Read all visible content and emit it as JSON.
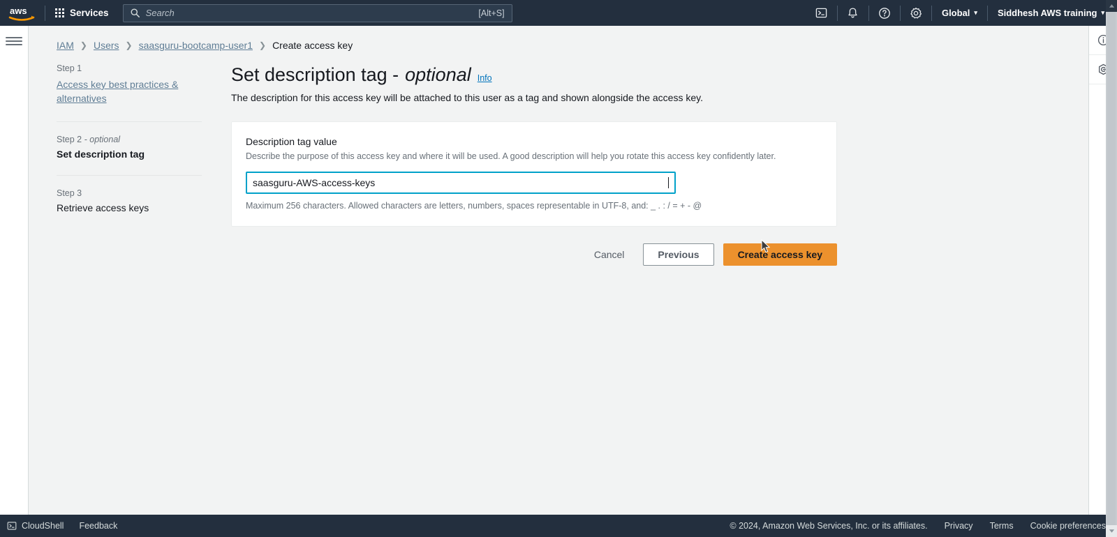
{
  "header": {
    "logo_alt": "aws",
    "services_label": "Services",
    "search": {
      "placeholder": "Search",
      "value": "",
      "shortcut": "[Alt+S]",
      "icon": "search-icon"
    },
    "icons": [
      {
        "name": "cloudshell-icon",
        "label": "CloudShell"
      },
      {
        "name": "bell-icon",
        "label": "Notifications"
      },
      {
        "name": "help-icon",
        "label": "Help"
      },
      {
        "name": "settings-icon",
        "label": "Settings"
      }
    ],
    "region_label": "Global",
    "account_label": "Siddhesh AWS training",
    "caret": "▾"
  },
  "breadcrumb": {
    "items": [
      {
        "label": "IAM",
        "link": true
      },
      {
        "label": "Users",
        "link": true
      },
      {
        "label": "saasguru-bootcamp-user1",
        "link": true
      },
      {
        "label": "Create access key",
        "link": false
      }
    ],
    "separator": "❯"
  },
  "steps": [
    {
      "step_label": "Step 1",
      "optional": false,
      "title": "Access key best practices & alternatives",
      "active": false,
      "link": true
    },
    {
      "step_label": "Step 2",
      "optional": true,
      "optional_text": "- optional",
      "title": "Set description tag",
      "active": true,
      "link": false
    },
    {
      "step_label": "Step 3",
      "optional": false,
      "title": "Retrieve access keys",
      "active": false,
      "link": false
    }
  ],
  "main": {
    "title": "Set description tag -",
    "title_italic": "optional",
    "info_label": "Info",
    "subtitle": "The description for this access key will be attached to this user as a tag and shown alongside the access key.",
    "panel": {
      "field_label": "Description tag value",
      "field_description": "Describe the purpose of this access key and where it will be used. A good description will help you rotate this access key confidently later.",
      "input_value": "saasguru-AWS-access-keys",
      "input_placeholder": "",
      "constraint": "Maximum 256 characters. Allowed characters are letters, numbers, spaces representable in UTF-8, and: _ . : / = + - @"
    },
    "actions": {
      "cancel_label": "Cancel",
      "previous_label": "Previous",
      "create_label": "Create access key"
    }
  },
  "right_rail": [
    {
      "name": "info-panel-icon"
    },
    {
      "name": "security-shield-icon"
    }
  ],
  "footer": {
    "cloudshell_label": "CloudShell",
    "feedback_label": "Feedback",
    "copyright": "© 2024, Amazon Web Services, Inc. or its affiliates.",
    "privacy_label": "Privacy",
    "terms_label": "Terms",
    "cookie_label": "Cookie preferences"
  },
  "colors": {
    "nav_bg": "#232f3e",
    "page_bg": "#f2f3f3",
    "primary_button": "#ec912d",
    "link": "#5f7d95",
    "info_link": "#0073bb",
    "input_focus_border": "#00a1c9"
  }
}
